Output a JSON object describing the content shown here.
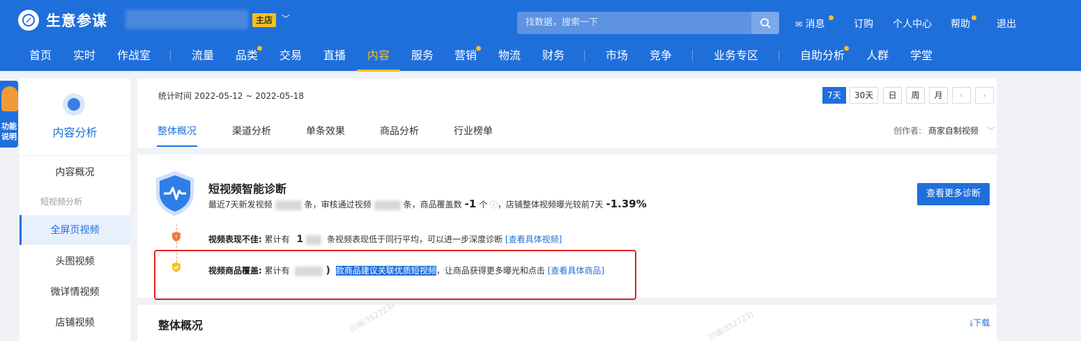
{
  "header": {
    "logo_text": "生意参谋",
    "shop_badge": "主店",
    "search_placeholder": "找数据，搜索一下",
    "links": {
      "messages": "消息",
      "orders": "订购",
      "profile": "个人中心",
      "help": "帮助",
      "logout": "退出"
    },
    "accent_color": "#1f6fdb",
    "badge_color": "#f5c21b"
  },
  "nav": {
    "items": [
      "首页",
      "实时",
      "作战室",
      "流量",
      "品类",
      "交易",
      "直播",
      "内容",
      "服务",
      "营销",
      "物流",
      "财务",
      "市场",
      "竞争",
      "业务专区",
      "自助分析",
      "人群",
      "学堂"
    ],
    "active": "内容"
  },
  "helper": {
    "label": "功能说明"
  },
  "sidebar": {
    "title": "内容分析",
    "items": {
      "overview": "内容概况",
      "group": "短视频分析",
      "fullscreen": "全屏页视频",
      "headimg": "头图视频",
      "detail": "微详情视频",
      "store": "店铺视频"
    },
    "active": "全屏页视频"
  },
  "top_card": {
    "stat_time": "统计时间 2022-05-12 ~ 2022-05-18",
    "date_buttons": [
      "7天",
      "30天",
      "日",
      "周",
      "月"
    ],
    "prev": "‹",
    "next": "›",
    "tabs": [
      "整体概况",
      "渠道分析",
      "单条效果",
      "商品分析",
      "行业榜单"
    ],
    "creator_label": "创作者:",
    "creator_value": "商家自制视频"
  },
  "diagnosis": {
    "title": "短视频智能诊断",
    "summary": {
      "part1": "最近7天新发视频",
      "part2": "条，审核通过视频",
      "part3": "条，商品覆盖数",
      "coverage": "-1",
      "part4": "个",
      "part5": "，店铺整体视频曝光较前7天",
      "exposure_change": "-1.39%"
    },
    "more_button": "查看更多诊断",
    "row1": {
      "label": "视频表现不佳:",
      "prefix": "累计有",
      "count_visible": "1",
      "text": "条视频表现低于同行平均，可以进一步深度诊断",
      "link": "[查看具体视频]"
    },
    "row2": {
      "label": "视频商品覆盖:",
      "prefix": "累计有",
      "highlight": "款商品建议关联优质短视频",
      "text": "，让商品获得更多曝光和点击",
      "link": "[查看具体商品]"
    }
  },
  "section": {
    "title": "整体概况",
    "download": "下载",
    "watermark": "贝瑞(352723)"
  }
}
